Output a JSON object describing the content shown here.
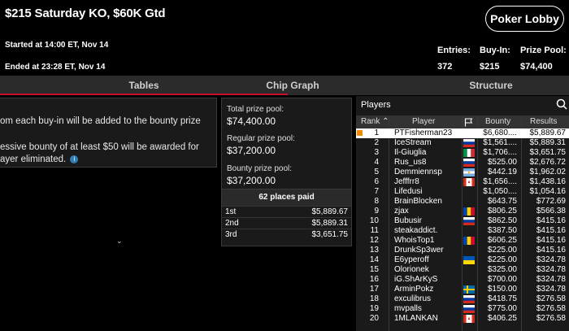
{
  "header": {
    "title": "$215 Saturday KO, $60K Gtd",
    "started": "Started at 14:00 ET, Nov 14",
    "ended": "Ended at 23:28 ET, Nov 14",
    "lobby_button": "Poker Lobby",
    "stats": [
      {
        "label": "Entries:",
        "value": "372"
      },
      {
        "label": "Buy-In:",
        "value": "$215"
      },
      {
        "label": "Prize Pool:",
        "value": "$74,400"
      }
    ]
  },
  "tabs": [
    {
      "label": "Tables",
      "active": true
    },
    {
      "label": "Chip Graph",
      "active": false
    },
    {
      "label": "Structure",
      "active": false
    }
  ],
  "info_panel": {
    "line1": "om each buy-in will be added to the bounty prize",
    "line2": "essive bounty of at least $50 will be awarded for",
    "line3": "ayer eliminated.",
    "info_icon": "i"
  },
  "prize": {
    "total_label": "Total prize pool:",
    "total_value": "$74,400.00",
    "regular_label": "Regular prize pool:",
    "regular_value": "$37,200.00",
    "bounty_label": "Bounty prize pool:",
    "bounty_value": "$37,200.00"
  },
  "places": {
    "header": "62 places paid",
    "rows": [
      {
        "pos": "1st",
        "amount": "$5,889.67"
      },
      {
        "pos": "2nd",
        "amount": "$5,889.31"
      },
      {
        "pos": "3rd",
        "amount": "$3,651.75"
      }
    ]
  },
  "players_panel": {
    "title": "Players",
    "columns": {
      "rank": "Rank",
      "player": "Player",
      "bounty": "Bounty",
      "results": "Results"
    },
    "rows": [
      {
        "rank": "1",
        "name": "PTFisherman23",
        "bounty": "$6,680....",
        "result": "$5,889.67",
        "flag": "none"
      },
      {
        "rank": "2",
        "name": "IceStream",
        "bounty": "$1,561....",
        "result": "$5,889.31",
        "flag": "russia"
      },
      {
        "rank": "3",
        "name": "Il-Giuglia",
        "bounty": "$1,706....",
        "result": "$3,651.75",
        "flag": "italy"
      },
      {
        "rank": "4",
        "name": "Rus_us8",
        "bounty": "$525.00",
        "result": "$2,676.72",
        "flag": "russia"
      },
      {
        "rank": "5",
        "name": "Demmiennsp",
        "bounty": "$442.19",
        "result": "$1,962.02",
        "flag": "argentina"
      },
      {
        "rank": "6",
        "name": "Jefffrr8",
        "bounty": "$1,656....",
        "result": "$1,438.16",
        "flag": "canada"
      },
      {
        "rank": "7",
        "name": "Lifedusi",
        "bounty": "$1,050....",
        "result": "$1,054.16",
        "flag": "none"
      },
      {
        "rank": "8",
        "name": "BrainBlocken",
        "bounty": "$643.75",
        "result": "$772.69",
        "flag": "none"
      },
      {
        "rank": "9",
        "name": "zjax",
        "bounty": "$806.25",
        "result": "$566.38",
        "flag": "moldova"
      },
      {
        "rank": "10",
        "name": "Bubusir",
        "bounty": "$862.50",
        "result": "$415.16",
        "flag": "russia"
      },
      {
        "rank": "11",
        "name": "steakaddict.",
        "bounty": "$387.50",
        "result": "$415.16",
        "flag": "none"
      },
      {
        "rank": "12",
        "name": "WhoisTop1",
        "bounty": "$606.25",
        "result": "$415.16",
        "flag": "moldova"
      },
      {
        "rank": "13",
        "name": "DrunkSp3wer",
        "bounty": "$225.00",
        "result": "$415.16",
        "flag": "none"
      },
      {
        "rank": "14",
        "name": "E6yperoff",
        "bounty": "$225.00",
        "result": "$324.78",
        "flag": "ukraine"
      },
      {
        "rank": "15",
        "name": "Olorionek",
        "bounty": "$325.00",
        "result": "$324.78",
        "flag": "none"
      },
      {
        "rank": "16",
        "name": "iG.ShArKyS",
        "bounty": "$700.00",
        "result": "$324.78",
        "flag": "none"
      },
      {
        "rank": "17",
        "name": "ArminPokz",
        "bounty": "$150.00",
        "result": "$324.78",
        "flag": "sweden"
      },
      {
        "rank": "18",
        "name": "exculibrus",
        "bounty": "$418.75",
        "result": "$276.58",
        "flag": "russia"
      },
      {
        "rank": "19",
        "name": "mvpalls",
        "bounty": "$775.00",
        "result": "$276.58",
        "flag": "russia"
      },
      {
        "rank": "20",
        "name": "1MLANKAN",
        "bounty": "$406.25",
        "result": "$276.58",
        "flag": "canada"
      }
    ]
  },
  "colors": {
    "accent": "#c8102e",
    "selection_marker": "#f08a00",
    "background": "#000000"
  }
}
